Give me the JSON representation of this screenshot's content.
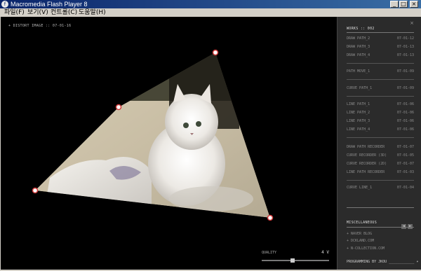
{
  "window": {
    "title": "Macromedia Flash Player 8",
    "minimize": "_",
    "maximize": "□",
    "close": "×"
  },
  "menu": [
    "파일(F)",
    "보기(V)",
    "컨트롤(C)",
    "도움말(H)"
  ],
  "stage": {
    "label": "+ DISTORT IMAGE :: 07-01-16",
    "quality_label": "QUALITY",
    "quality_value": "4 V",
    "quality_level": 0.45
  },
  "panel": {
    "close": "×",
    "works_heading": "WORKS :: 002",
    "groups": [
      [
        {
          "name": "DRAW PATH_2",
          "date": "07-01-12"
        },
        {
          "name": "DRAW PATH_3",
          "date": "07-01-13"
        },
        {
          "name": "DRAW PATH_4",
          "date": "07-01-13"
        }
      ],
      [
        {
          "name": "PATH MOVE_1",
          "date": "07-01-09"
        }
      ],
      [
        {
          "name": "CURVE PATH_1",
          "date": "07-01-09"
        }
      ],
      [
        {
          "name": "LINE PATH_1",
          "date": "07-01-06"
        },
        {
          "name": "LINE PATH_2",
          "date": "07-01-06"
        },
        {
          "name": "LINE PATH_3",
          "date": "07-01-06"
        },
        {
          "name": "LINE PATH_4",
          "date": "07-01-06"
        }
      ],
      [
        {
          "name": "DRAW PATH RECORDER",
          "date": "07-01-07"
        },
        {
          "name": "CURVE RECORDER (3D)",
          "date": "07-01-05"
        },
        {
          "name": "CURVE RECORDER (2D)",
          "date": "07-01-07"
        },
        {
          "name": "LINE PATH RECORDER",
          "date": "07-01-03"
        }
      ],
      [
        {
          "name": "CURVE LINE_1",
          "date": "07-01-04"
        }
      ]
    ],
    "pager_prev": "◂",
    "pager_next": "▸",
    "misc_heading": "MISCELLANEOUS",
    "links": [
      "+ NAVER BLOG",
      "+ DCKLAND.COM",
      "+ N-COLLECTION.COM"
    ],
    "credit": "PROGRAMMING BY JKOU ____________ ▾"
  }
}
